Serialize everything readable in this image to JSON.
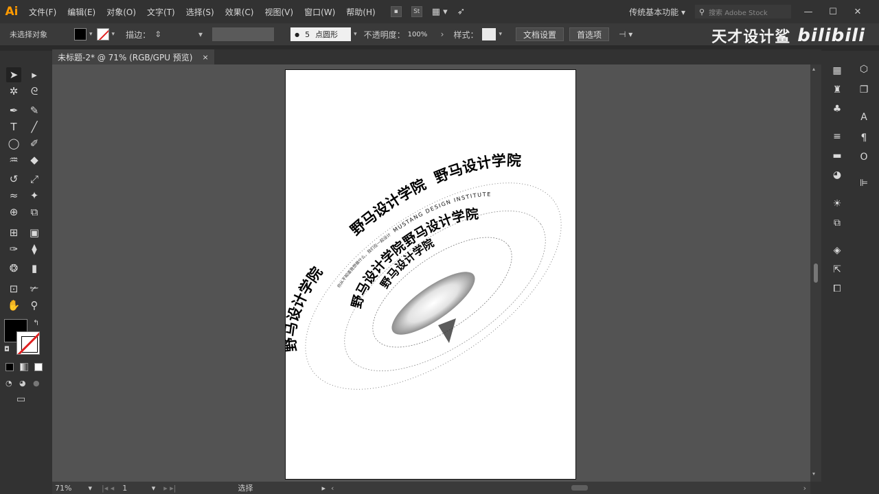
{
  "app": {
    "logo": "Ai"
  },
  "menu": [
    "文件(F)",
    "编辑(E)",
    "对象(O)",
    "文字(T)",
    "选择(S)",
    "效果(C)",
    "视图(V)",
    "窗口(W)",
    "帮助(H)"
  ],
  "menubar_right": {
    "workspace": "传统基本功能",
    "search_placeholder": "搜索 Adobe Stock"
  },
  "control_bar": {
    "selection_label": "未选择对象",
    "stroke_label": "描边：",
    "brush_size": "5",
    "brush_label": "点圆形",
    "opacity_label": "不透明度：",
    "opacity_value": "100%",
    "style_label": "样式：",
    "doc_settings": "文档设置",
    "preferences": "首选项"
  },
  "watermark": {
    "text": "天才设计鲨",
    "brand": "bilibili"
  },
  "document_tab": {
    "title": "未标题-2* @ 71% (RGB/GPU 预览)",
    "close": "×"
  },
  "artwork": {
    "outer_text": "野马设计学院",
    "inner_text": "野马设计学院",
    "english_text": "MUSTANG DESIGN INSTITUTE",
    "small_text": "你从不知道我想做什么，我们在一起设计"
  },
  "status": {
    "zoom": "71%",
    "page": "1",
    "tool": "选择"
  },
  "icons": {
    "tools": [
      "select-arrow-icon",
      "direct-select-icon",
      "magic-wand-icon",
      "lasso-icon",
      "pen-icon",
      "curvature-icon",
      "type-icon",
      "line-icon",
      "ellipse-icon",
      "paintbrush-icon",
      "shaper-icon",
      "eraser-icon",
      "rotate-icon",
      "scale-icon",
      "width-icon",
      "puppet-warp-icon",
      "shape-builder-icon",
      "perspective-icon",
      "mesh-icon",
      "gradient-icon",
      "eyedropper-icon",
      "blend-icon",
      "symbol-sprayer-icon",
      "graph-icon",
      "artboard-icon",
      "slice-icon",
      "hand-icon",
      "zoom-icon"
    ]
  },
  "colors": {
    "accent_logo": "#ff9a00",
    "stroke_none": "#e02020"
  }
}
